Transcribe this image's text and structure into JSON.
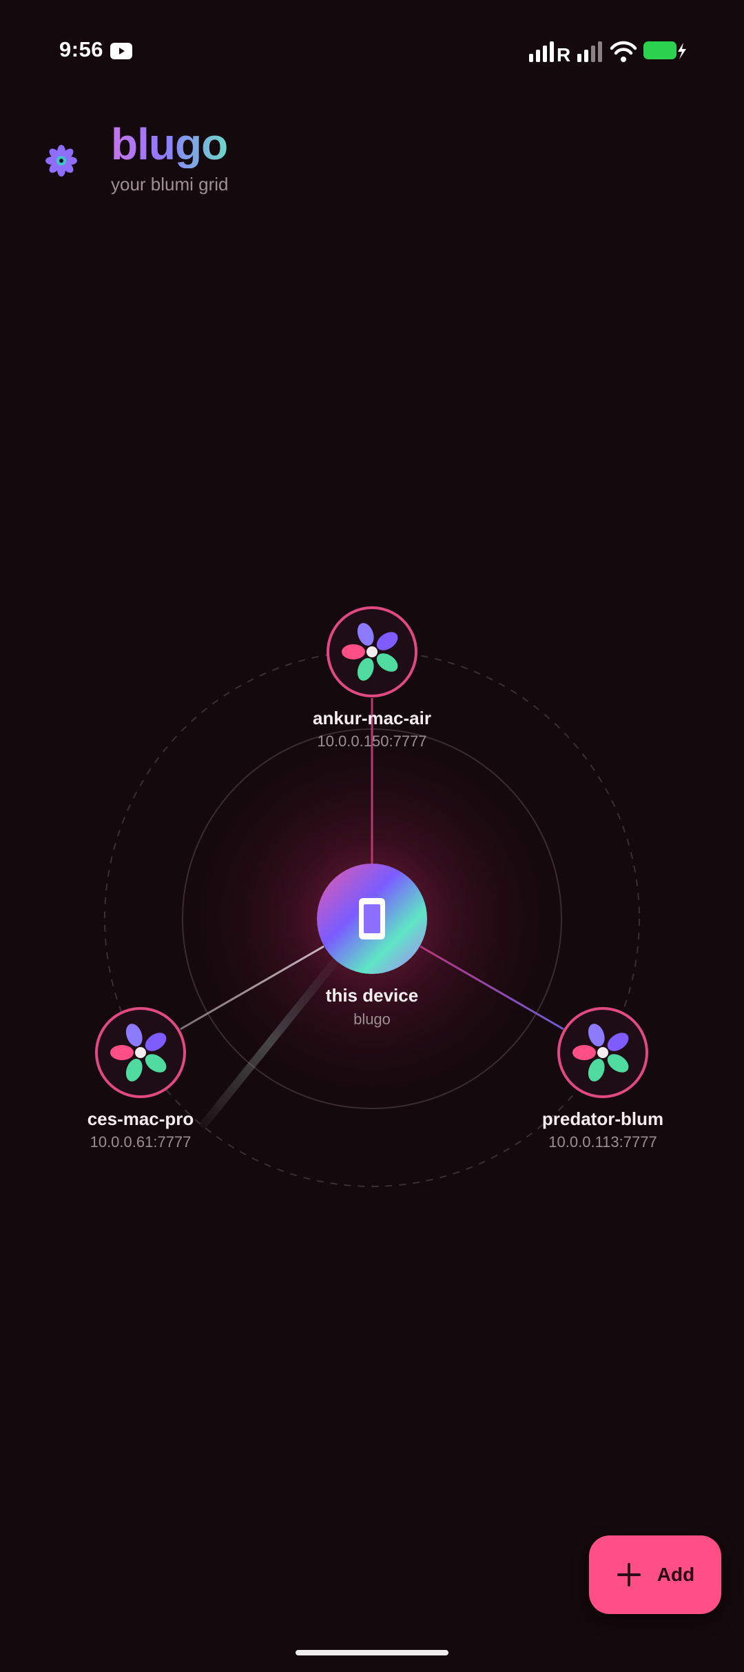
{
  "status_bar": {
    "time": "9:56",
    "carrier_tag": "R",
    "icons": [
      "youtube-icon",
      "signal-icon",
      "signal-icon",
      "wifi-icon",
      "battery-charging-icon"
    ]
  },
  "header": {
    "title": "blugo",
    "subtitle": "your blumi grid",
    "logo_icon": "flower-icon"
  },
  "network": {
    "center": {
      "name": "this device",
      "sub": "blugo",
      "icon": "phone-icon"
    },
    "peers": [
      {
        "name": "ankur-mac-air",
        "address": "10.0.0.150:7777",
        "icon": "flower-icon"
      },
      {
        "name": "ces-mac-pro",
        "address": "10.0.0.61:7777",
        "icon": "flower-icon"
      },
      {
        "name": "predator-blum",
        "address": "10.0.0.113:7777",
        "icon": "flower-icon"
      }
    ]
  },
  "fab": {
    "label": "Add",
    "icon": "plus-icon"
  },
  "colors": {
    "background": "#14090d",
    "accent": "#ff4f86",
    "node_ring": "#e04a80",
    "petal_purple": "#8d7bff",
    "petal_violet": "#7f5cff",
    "petal_pink": "#ff4f86",
    "petal_green": "#4fdba0"
  }
}
